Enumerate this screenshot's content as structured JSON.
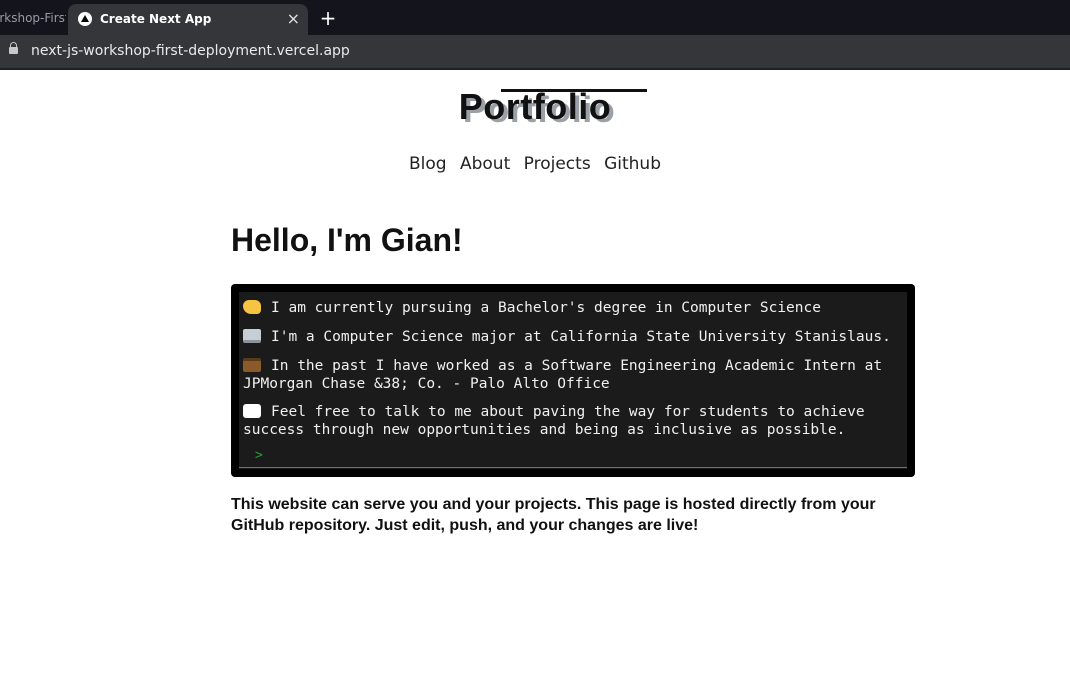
{
  "browser": {
    "prev_tab_label": "orkshop-First",
    "active_tab_title": "Create Next App",
    "close_glyph": "×",
    "new_tab_glyph": "+",
    "url": "next-js-workshop-first-deployment.vercel.app"
  },
  "site": {
    "logo": "Portfolio",
    "nav": [
      "Blog",
      "About",
      "Projects",
      "Github"
    ]
  },
  "main": {
    "heading": "Hello, I'm Gian!",
    "terminal": {
      "lines": [
        {
          "icon": "waving-hand-icon",
          "text": "I am currently pursuing a Bachelor's degree in Computer Science"
        },
        {
          "icon": "laptop-icon",
          "text": "I'm a Computer Science major at California State University Stanislaus."
        },
        {
          "icon": "briefcase-icon",
          "text": "In the past I have worked as a Software Engineering Academic Intern at JPMorgan Chase &38; Co. - Palo Alto Office"
        },
        {
          "icon": "speech-bubble-icon",
          "text": "Feel free to talk to me about paving the way for students to achieve success through new opportunities and being as inclusive as possible."
        }
      ],
      "prompt": ">",
      "prompt_color": "#2e9a3a"
    },
    "description": "This website can serve you and your projects. This page is hosted directly from your GitHub repository. Just edit, push, and your changes are live!"
  }
}
